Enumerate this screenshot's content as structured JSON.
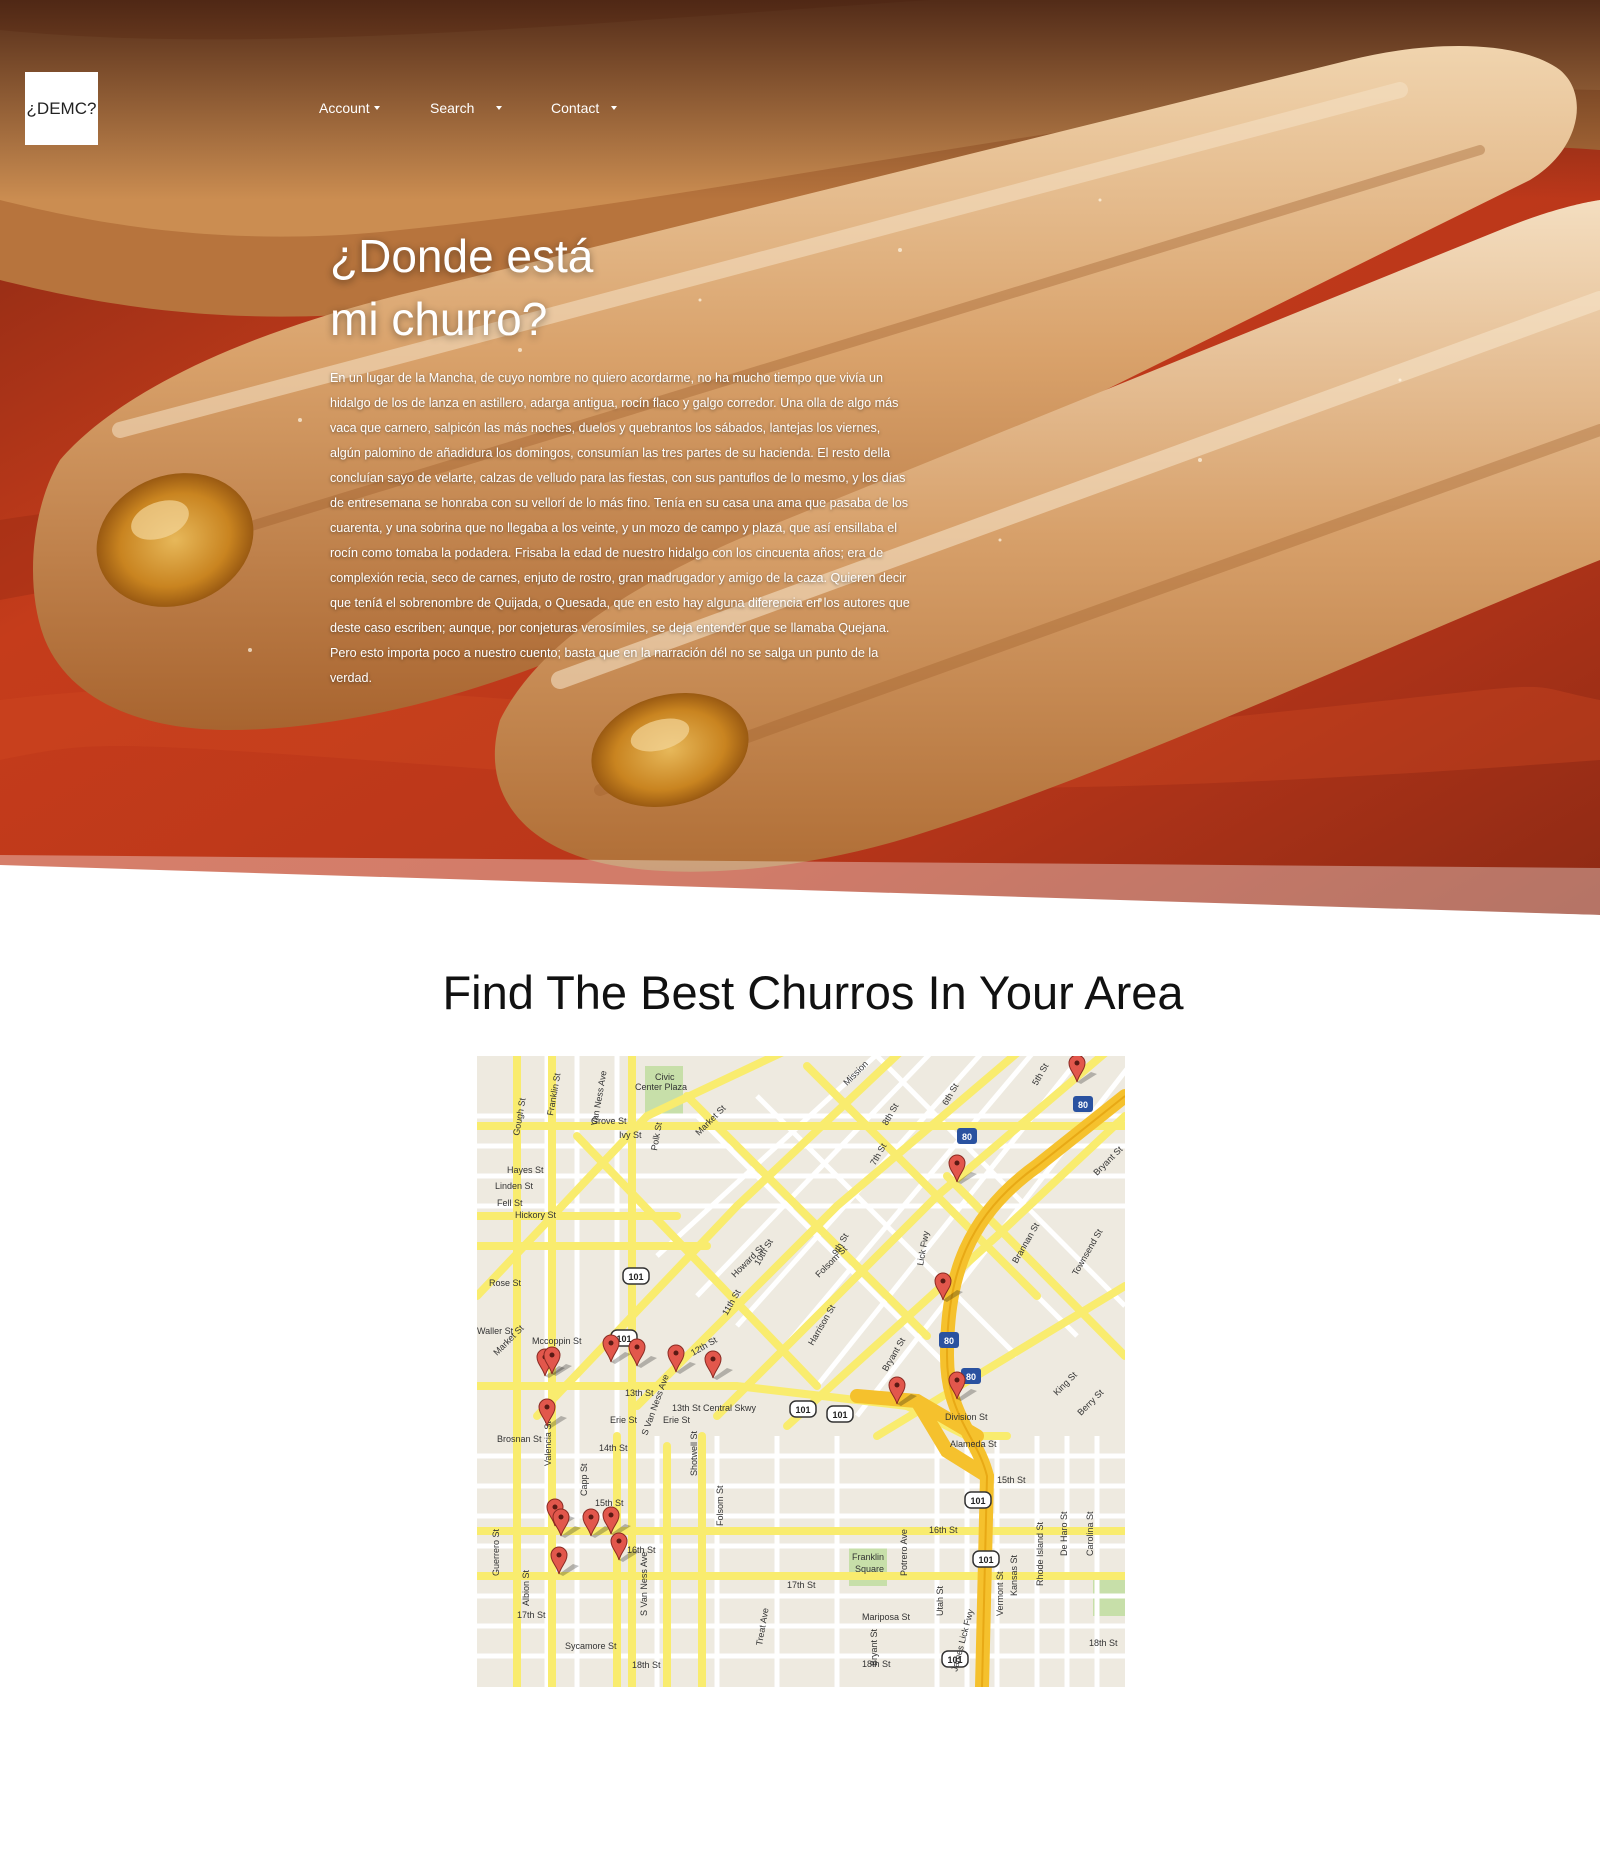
{
  "header": {
    "logo_text": "¿DEMC?",
    "nav": [
      {
        "label": "Account"
      },
      {
        "label": "Search"
      },
      {
        "label": "Contact"
      }
    ]
  },
  "hero": {
    "title_line1": "¿Donde está",
    "title_line2": "mi churro?",
    "body": "En un lugar de la Mancha, de cuyo nombre no quiero acordarme, no ha mucho tiempo que vivía un hidalgo de los de lanza en astillero, adarga antigua, rocín flaco y galgo corredor. Una olla de algo más vaca que carnero, salpicón las más noches, duelos y quebrantos los sábados, lantejas los viernes, algún palomino de añadidura los domingos, consumían las tres partes de su hacienda. El resto della concluían sayo de velarte, calzas de velludo para las fiestas, con sus pantuflos de lo mesmo, y los días de entresemana se honraba con su vellorí de lo más fino. Tenía en su casa una ama que pasaba de los cuarenta, y una sobrina que no llegaba a los veinte, y un mozo de campo y plaza, que así ensillaba el rocín como tomaba la podadera. Frisaba la edad de nuestro hidalgo con los cincuenta años; era de complexión recia, seco de carnes, enjuto de rostro, gran madrugador y amigo de la caza. Quieren decir que tenía el sobrenombre de Quijada, o Quesada, que en esto hay alguna diferencia en los autores que deste caso escriben; aunque, por conjeturas verosímiles, se deja entender que se llamaba Quejana. Pero esto importa poco a nuestro cuento; basta que en la narración dél no se salga un punto de la verdad."
  },
  "colors": {
    "road_yellow": "#f9ec6e",
    "freeway": "#f5c12d",
    "marker_red": "#e2574c",
    "park_green": "#c7dfa9",
    "hero_red": "#b8341a"
  },
  "section": {
    "title": "Find The Best Churros In Your Area"
  },
  "map": {
    "labels": {
      "civic": "Civic",
      "center_plaza": "Center Plaza",
      "franklin_square_1": "Franklin",
      "franklin_square_2": "Square",
      "market": "Market St",
      "mission": "Mission",
      "howard": "Howard St",
      "folsom": "Folsom St",
      "bryant": "Bryant St",
      "harrison": "Harrison St",
      "division": "Division St",
      "alameda": "Alameda St",
      "central_skwy": "13th St Central Skwy",
      "st13": "13th St",
      "st14": "14th St",
      "st15": "15th St",
      "st16": "16th St",
      "st17": "17th St",
      "st18": "18th St",
      "mariposa": "Mariposa St",
      "svanness": "S Van Ness Ave",
      "vanness": "Van Ness Ave",
      "valencia": "Valencia St",
      "guerrero": "Guerrero St",
      "gough": "Gough St",
      "franklin": "Franklin St",
      "hayes": "Hayes St",
      "fell": "Fell St",
      "grove": "Grove St",
      "ivy": "Ivy St",
      "linden": "Linden St",
      "hickory": "Hickory St",
      "rose": "Rose St",
      "waller": "Waller St",
      "mccoppin": "Mccoppin St",
      "brosnan": "Brosnan St",
      "erie": "Erie St",
      "potrero": "Potrero Ave",
      "hampshire": "James Lick Fwy",
      "townsend": "Townsend St",
      "brannan": "Brannan St",
      "king": "King St",
      "berry": "Berry St",
      "polk": "Polk St",
      "ninth": "9th St",
      "eighth": "8th St",
      "seventh": "7th St",
      "sixth": "6th St",
      "fifth": "5th St",
      "tenth": "10th St",
      "eleventh": "11th St",
      "twelfth": "12th St",
      "capp": "Capp St",
      "shotwell": "Shotwell St",
      "albion": "Albion St",
      "sycamore": "Sycamore St",
      "treat": "Treat Ave",
      "utah": "Utah St",
      "vermont": "Vermont St",
      "kansas": "Kansas St",
      "rhode": "Rhode Island St",
      "dehaaro": "De Haro St",
      "carolina": "Carolina St",
      "lick": "Lick Fwy",
      "hwy101": "101",
      "i80": "80"
    }
  }
}
